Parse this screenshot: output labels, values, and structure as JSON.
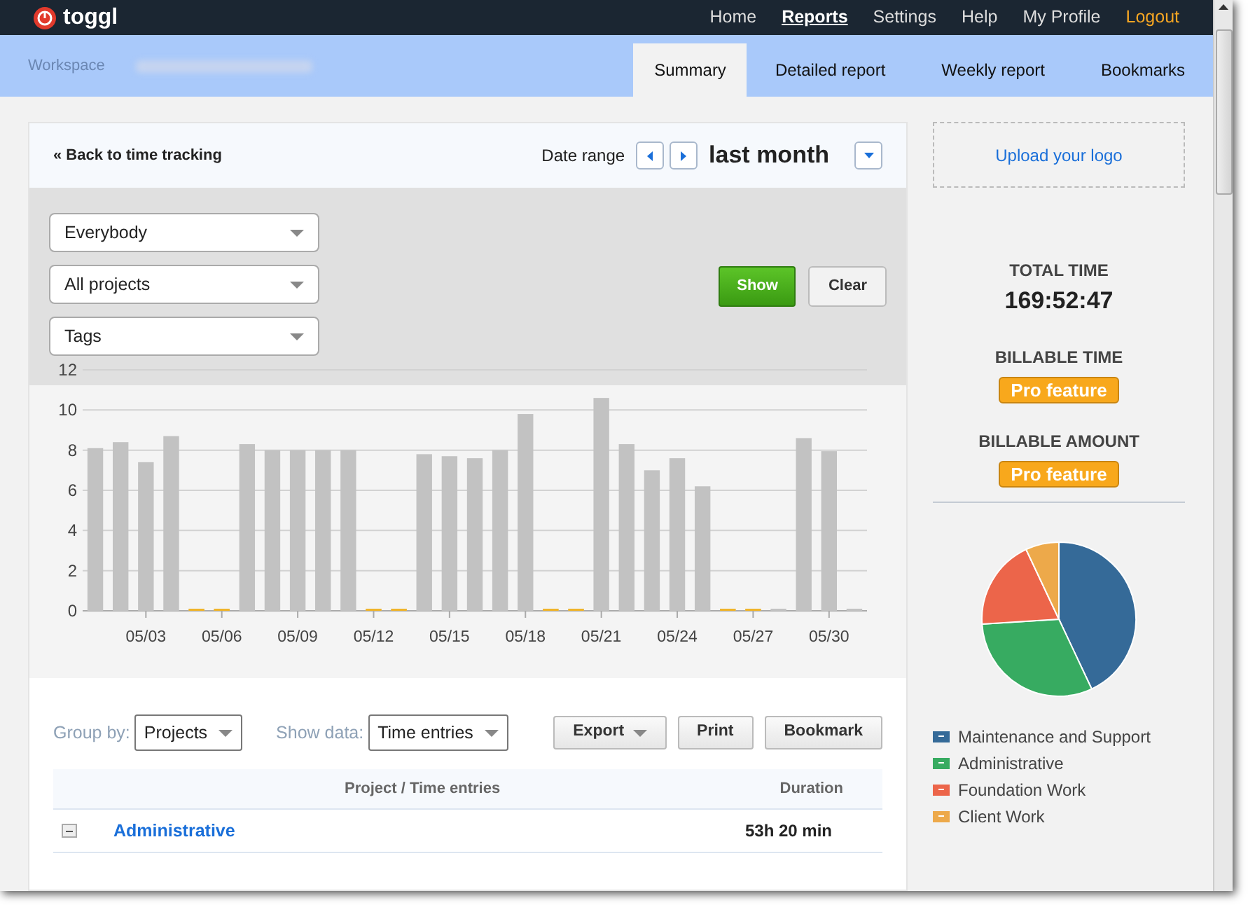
{
  "brand": {
    "name": "toggl"
  },
  "top_nav": [
    {
      "label": "Home",
      "selected": false,
      "kind": "link"
    },
    {
      "label": "Reports",
      "selected": true,
      "kind": "link"
    },
    {
      "label": "Settings",
      "selected": false,
      "kind": "link"
    },
    {
      "label": "Help",
      "selected": false,
      "kind": "link"
    },
    {
      "label": "My Profile",
      "selected": false,
      "kind": "link"
    },
    {
      "label": "Logout",
      "selected": false,
      "kind": "logout"
    }
  ],
  "workspace": {
    "label": "Workspace"
  },
  "tabs": [
    {
      "label": "Summary",
      "selected": true
    },
    {
      "label": "Detailed report",
      "selected": false
    },
    {
      "label": "Weekly report",
      "selected": false
    },
    {
      "label": "Bookmarks",
      "selected": false
    }
  ],
  "header": {
    "back_link": "« Back to time tracking",
    "date_range_label": "Date range",
    "period": "last month"
  },
  "filters": [
    {
      "value": "Everybody"
    },
    {
      "value": "All projects"
    },
    {
      "value": "Tags"
    }
  ],
  "filter_buttons": [
    {
      "label": "Show",
      "kind": "primary"
    },
    {
      "label": "Clear",
      "kind": "secondary"
    }
  ],
  "chart_data": {
    "type": "bar",
    "stacked": true,
    "grid": true,
    "categories": [
      null,
      null,
      "05/03",
      null,
      null,
      "05/06",
      null,
      null,
      "05/09",
      null,
      null,
      "05/12",
      null,
      null,
      "05/15",
      null,
      null,
      "05/18",
      null,
      null,
      "05/21",
      null,
      null,
      "05/24",
      null,
      null,
      "05/27",
      null,
      null,
      "05/30",
      null
    ],
    "series": [
      {
        "color": "#c2c2c2",
        "values": [
          8.1,
          8.4,
          7.4,
          8.7,
          0,
          0,
          8.3,
          8.0,
          8.0,
          8.0,
          8.0,
          0,
          0,
          7.8,
          7.7,
          7.6,
          8.0,
          9.8,
          0,
          0,
          10.6,
          8.3,
          7.0,
          7.6,
          6.2,
          0,
          0,
          0,
          8.6,
          7.95,
          0
        ]
      },
      {
        "color": "#f0b429",
        "values": [
          null,
          null,
          null,
          null,
          0,
          0,
          null,
          null,
          null,
          null,
          null,
          0,
          0,
          null,
          null,
          null,
          null,
          null,
          0,
          0,
          null,
          null,
          null,
          null,
          null,
          0,
          0,
          null,
          null,
          null,
          null
        ]
      }
    ],
    "ylim": [
      0,
      12
    ],
    "yticks": [
      0,
      2,
      4,
      6,
      8,
      10,
      12
    ]
  },
  "report_controls": {
    "group_by_label": "Group by:",
    "group_by": "Projects",
    "show_data_label": "Show data:",
    "show_data": "Time entries",
    "buttons": [
      {
        "label": "Export",
        "kind": "dropdown"
      },
      {
        "label": "Print",
        "kind": "plain"
      },
      {
        "label": "Bookmark",
        "kind": "plain"
      }
    ]
  },
  "table": {
    "columns": [
      "Project / Time entries",
      "Duration"
    ],
    "rows": [
      {
        "project": "Administrative",
        "duration": "53h 20 min",
        "expanded": true
      }
    ]
  },
  "sidebar": {
    "upload_logo": "Upload your logo",
    "total_time_label": "TOTAL TIME",
    "total_time": "169:52:47",
    "billable_time_label": "BILLABLE TIME",
    "billable_time_badge": "Pro feature",
    "billable_amount_label": "BILLABLE AMOUNT",
    "billable_amount_badge": "Pro feature",
    "legend": [
      {
        "label": "Maintenance and Support",
        "color": "#356a98"
      },
      {
        "label": "Administrative",
        "color": "#37ab61"
      },
      {
        "label": "Foundation Work",
        "color": "#ec654a"
      },
      {
        "label": "Client Work",
        "color": "#eda94a"
      }
    ]
  }
}
